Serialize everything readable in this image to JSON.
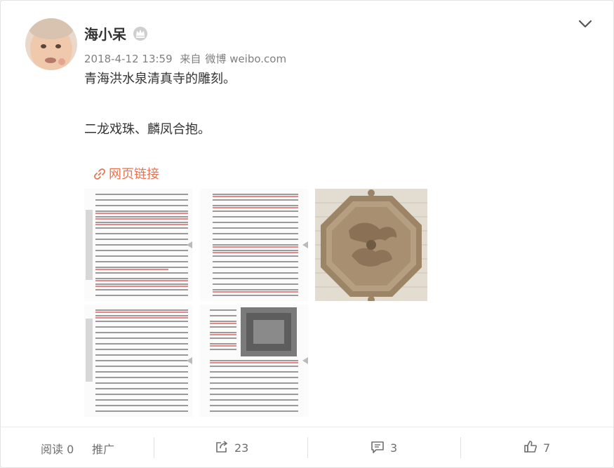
{
  "post": {
    "username": "海小呆",
    "timestamp": "2018-4-12 13:59",
    "source_prefix": "来自",
    "source": "微博 weibo.com",
    "text_line1": "青海洪水泉清真寺的雕刻。",
    "text_line2": "二龙戏珠、麟凤合抱。",
    "link_label": "网页链接",
    "images": [
      "book-page-scan",
      "book-page-scan",
      "carved-stone-panel",
      "book-page-scan",
      "book-page-scan-with-photo"
    ]
  },
  "footer": {
    "read_label": "阅读",
    "read_count": "0",
    "promote_label": "推广",
    "repost_count": "23",
    "comment_count": "3",
    "like_count": "7"
  },
  "icons": [
    "user-avatar",
    "crown-icon",
    "chevron-down-icon",
    "link-icon",
    "repost-icon",
    "comment-icon",
    "like-icon"
  ],
  "colors": {
    "link": "#eb7350",
    "text": "#333333",
    "meta": "#808080"
  }
}
